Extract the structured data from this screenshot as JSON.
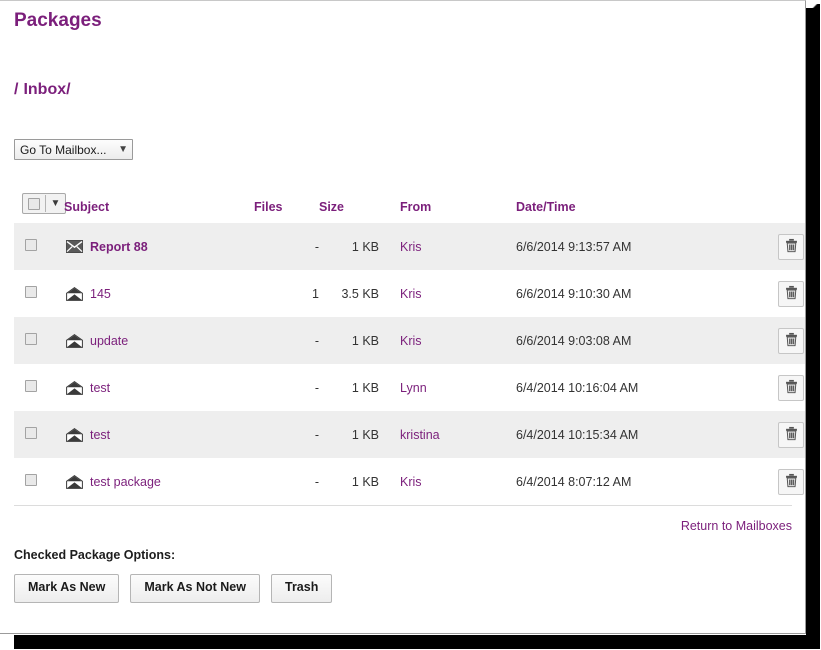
{
  "page": {
    "title": "Packages",
    "breadcrumb": {
      "separator": "/",
      "current": "Inbox/"
    }
  },
  "mailbox_select": {
    "selected": "Go To Mailbox...",
    "chevron": "chevron-down-icon"
  },
  "table": {
    "headers": {
      "subject": "Subject",
      "files": "Files",
      "size": "Size",
      "from": "From",
      "datetime": "Date/Time"
    },
    "rows": [
      {
        "state": "unread",
        "icon": "closed-envelope-icon",
        "subject": "Report 88",
        "files": "-",
        "size": "1 KB",
        "from": "Kris",
        "datetime": "6/6/2014 9:13:57 AM",
        "delete_icon": "trash-icon"
      },
      {
        "state": "read",
        "icon": "open-envelope-icon",
        "subject": "145",
        "files": "1",
        "size": "3.5 KB",
        "from": "Kris",
        "datetime": "6/6/2014 9:10:30 AM",
        "delete_icon": "trash-icon"
      },
      {
        "state": "read",
        "icon": "open-envelope-icon",
        "subject": "update",
        "files": "-",
        "size": "1 KB",
        "from": "Kris",
        "datetime": "6/6/2014 9:03:08 AM",
        "delete_icon": "trash-icon"
      },
      {
        "state": "read",
        "icon": "open-envelope-icon",
        "subject": "test",
        "files": "-",
        "size": "1 KB",
        "from": "Lynn",
        "datetime": "6/4/2014 10:16:04 AM",
        "delete_icon": "trash-icon"
      },
      {
        "state": "read",
        "icon": "open-envelope-icon",
        "subject": "test",
        "files": "-",
        "size": "1 KB",
        "from": "kristina",
        "datetime": "6/4/2014 10:15:34 AM",
        "delete_icon": "trash-icon"
      },
      {
        "state": "read",
        "icon": "open-envelope-icon",
        "subject": "test package",
        "files": "-",
        "size": "1 KB",
        "from": "Kris",
        "datetime": "6/4/2014 8:07:12 AM",
        "delete_icon": "trash-icon"
      }
    ]
  },
  "footer": {
    "return_link": "Return to Mailboxes",
    "checked_options_label": "Checked Package Options:",
    "buttons": {
      "mark_as_new": "Mark As New",
      "mark_as_not_new": "Mark As Not New",
      "trash": "Trash"
    }
  },
  "colors": {
    "accent": "#7b1f7b",
    "row_stripe": "#eeeeee",
    "text": "#333333"
  }
}
